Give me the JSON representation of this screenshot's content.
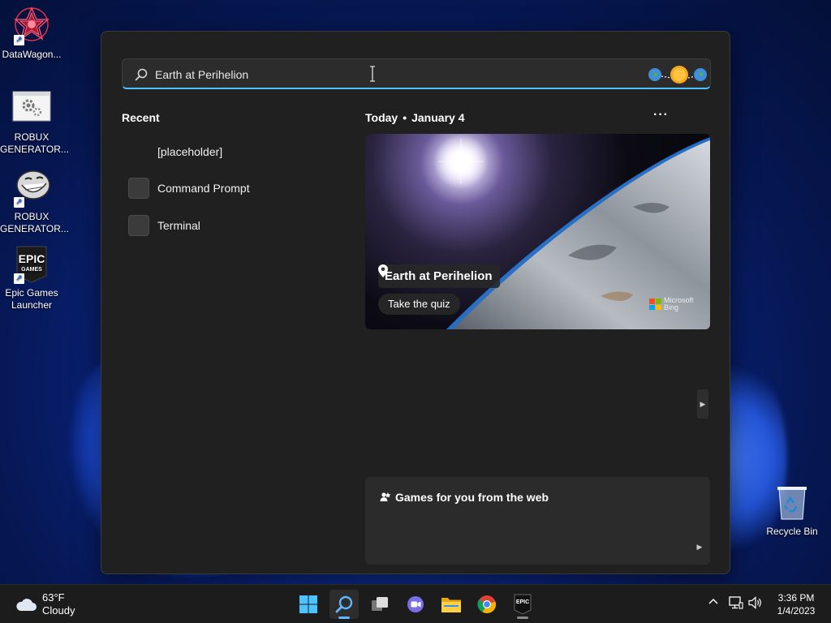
{
  "desktop": {
    "icons": [
      {
        "label": "DataWagon..."
      },
      {
        "label": "ROBUX GENERATOR..."
      },
      {
        "label": "ROBUX GENERATOR..."
      },
      {
        "label": "Epic Games Launcher"
      }
    ],
    "recycle_bin": {
      "label": "Recycle Bin"
    }
  },
  "search": {
    "query": "Earth at Perihelion",
    "icon": "search-icon"
  },
  "recent": {
    "title": "Recent",
    "items": [
      {
        "label": "[placeholder]"
      },
      {
        "label": "Command Prompt"
      },
      {
        "label": "Terminal"
      }
    ]
  },
  "today": {
    "label": "Today",
    "separator": "•",
    "date": "January 4",
    "more": "···"
  },
  "hero": {
    "location_label": "Earth at Perihelion",
    "quiz_button": "Take the quiz",
    "brand_line1": "Microsoft",
    "brand_line2": "Bing"
  },
  "games": {
    "title": "Games for you from the web"
  },
  "taskbar": {
    "weather": {
      "temp": "63°F",
      "condition": "Cloudy"
    },
    "clock": {
      "time": "3:36 PM",
      "date": "1/4/2023"
    },
    "epic_label": "EPIC"
  },
  "colors": {
    "accent": "#4cc2ff",
    "panel": "#202020",
    "card": "#2b2b2b"
  }
}
